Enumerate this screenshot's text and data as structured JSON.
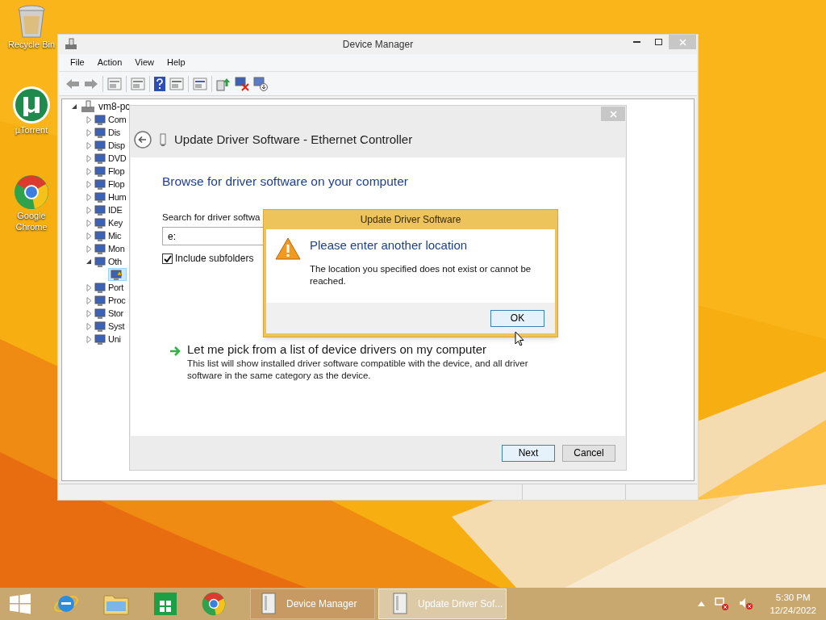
{
  "desktop_icons": [
    {
      "label": "Recycle Bin",
      "kind": "recycle"
    },
    {
      "label": "µTorrent",
      "kind": "torrent"
    },
    {
      "label": "Google Chrome",
      "kind": "chrome"
    }
  ],
  "device_manager": {
    "title": "Device Manager",
    "menu": [
      "File",
      "Action",
      "View",
      "Help"
    ],
    "tree": {
      "label": "vm8-pc",
      "expanded": true,
      "children": [
        {
          "label": "Com",
          "expanded": false
        },
        {
          "label": "Dis",
          "expanded": false
        },
        {
          "label": "Disp",
          "expanded": false
        },
        {
          "label": "DVD",
          "expanded": false
        },
        {
          "label": "Flop",
          "expanded": false
        },
        {
          "label": "Flop",
          "expanded": false
        },
        {
          "label": "Hum",
          "expanded": false
        },
        {
          "label": "IDE",
          "expanded": false
        },
        {
          "label": "Key",
          "expanded": false
        },
        {
          "label": "Mic",
          "expanded": false
        },
        {
          "label": "Mon",
          "expanded": false
        },
        {
          "label": "Oth",
          "expanded": true,
          "children": [
            {
              "kind": "warning-device",
              "selected": true
            }
          ]
        },
        {
          "label": "Port",
          "expanded": false
        },
        {
          "label": "Proc",
          "expanded": false
        },
        {
          "label": "Stor",
          "expanded": false
        },
        {
          "label": "Syst",
          "expanded": false
        },
        {
          "label": "Uni",
          "expanded": false
        }
      ]
    }
  },
  "wizard": {
    "title": "Update Driver Software - Ethernet Controller",
    "heading": "Browse for driver software on your computer",
    "search_label": "Search for driver softwa",
    "search_value": "e:",
    "include_subfolders": {
      "label": "Include subfolders",
      "checked": true
    },
    "link": "Let me pick from a list of device drivers on my computer",
    "link_description": "This list will show installed driver software compatible with the device, and all driver software in the same category as the device.",
    "buttons": [
      {
        "label": "Next",
        "default": true
      },
      {
        "label": "Cancel",
        "default": false
      }
    ]
  },
  "error_dialog": {
    "title": "Update Driver Software",
    "heading": "Please enter another location",
    "message": "The location you specified does not exist or cannot be reached.",
    "button": "OK"
  },
  "taskbar": {
    "tasks": [
      {
        "label": "Device Manager",
        "selected": false
      },
      {
        "label": "Update Driver Sof...",
        "selected": true
      }
    ],
    "time": "5:30 PM",
    "date": "12/24/2022"
  }
}
